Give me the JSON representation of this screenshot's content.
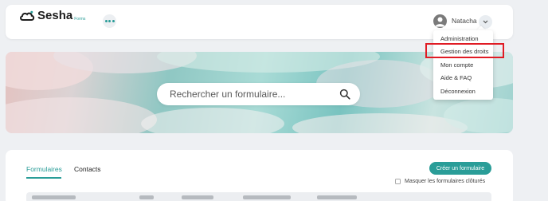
{
  "colors": {
    "accent": "#2a9d98",
    "highlight": "#e01b24",
    "background": "#eef0f3"
  },
  "header": {
    "logo_text": "Sesha",
    "logo_sub": "Forms",
    "apps_icon": "dots-icon",
    "user": {
      "name": "Natacha",
      "avatar_icon": "user-avatar-icon",
      "chevron_icon": "chevron-down-icon"
    }
  },
  "user_menu": {
    "items": [
      {
        "label": "Administration"
      },
      {
        "label": "Gestion des droits",
        "highlighted": true
      },
      {
        "label": "Mon compte"
      },
      {
        "label": "Aide & FAQ"
      },
      {
        "label": "Déconnexion"
      }
    ]
  },
  "search": {
    "placeholder": "Rechercher un formulaire...",
    "value": "",
    "icon": "search-icon"
  },
  "main": {
    "tabs": [
      {
        "label": "Formulaires",
        "active": true
      },
      {
        "label": "Contacts",
        "active": false
      }
    ],
    "create_button_label": "Créer un formulaire",
    "hide_closed_label": "Masquer les formulaires clôturés",
    "hide_closed_checked": false
  }
}
